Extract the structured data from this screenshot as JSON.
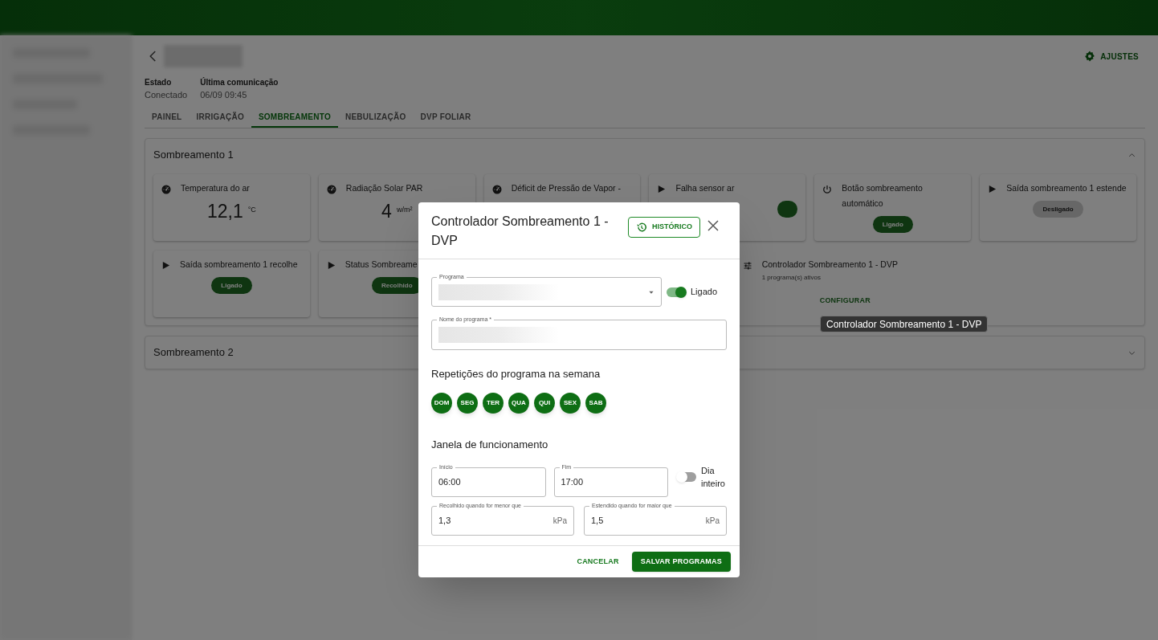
{
  "header": {
    "settings_button": "AJUSTES"
  },
  "status": [
    {
      "label": "Estado",
      "value": "Conectado"
    },
    {
      "label": "Última comunicação",
      "value": "06/09 09:45"
    }
  ],
  "tabs": [
    {
      "label": "PAINEL",
      "selected": false
    },
    {
      "label": "IRRIGAÇÃO",
      "selected": false
    },
    {
      "label": "SOMBREAMENTO",
      "selected": true
    },
    {
      "label": "NEBULIZAÇÃO",
      "selected": false
    },
    {
      "label": "DVP FOLIAR",
      "selected": false
    }
  ],
  "panels": [
    {
      "title": "Sombreamento 1",
      "expanded": true,
      "cards": [
        {
          "kind": "sensor",
          "title": "Temperatura do ar",
          "value": "12,1",
          "unit": "°C"
        },
        {
          "kind": "sensor",
          "title": "Radiação Solar PAR",
          "value": "4",
          "unit": "w/m²"
        },
        {
          "kind": "sensor",
          "title": "Déficit de Pressão de Vapor -"
        },
        {
          "kind": "output",
          "title": "Falha sensor ar",
          "badge_on": true
        },
        {
          "kind": "button",
          "title": "Botão sombreamento automático",
          "badge": "Ligado",
          "badge_on": true
        },
        {
          "kind": "output",
          "title": "Saída sombreamento 1 estende",
          "badge": "Desligado",
          "badge_on": false
        },
        {
          "kind": "output",
          "title": "Saída sombreamento 1 recolhe",
          "badge": "Ligado",
          "badge_on": true
        },
        {
          "kind": "output",
          "title": "Status Sombreame",
          "badge": "Recolhido",
          "badge_on": true
        },
        {
          "kind": "controller",
          "title": "Controlador Sombreamento 1 - DVP",
          "subtitle": "1 programa(s) ativos",
          "action": "CONFIGURAR"
        }
      ]
    },
    {
      "title": "Sombreamento 2",
      "expanded": false
    }
  ],
  "tooltip": "Controlador Sombreamento 1 - DVP",
  "dialog": {
    "title": "Controlador Sombreamento 1 - DVP",
    "history_button": "HISTÓRICO",
    "program": {
      "label": "Programa",
      "switch_label": "Ligado",
      "on": true
    },
    "name_field": {
      "label": "Nome do programa *"
    },
    "repeat_heading": "Repetições do programa na semana",
    "days": [
      {
        "label": "DOM",
        "selected": true
      },
      {
        "label": "SEG",
        "selected": true
      },
      {
        "label": "TER",
        "selected": true
      },
      {
        "label": "QUA",
        "selected": true
      },
      {
        "label": "QUI",
        "selected": true
      },
      {
        "label": "SEX",
        "selected": true
      },
      {
        "label": "SAB",
        "selected": true
      }
    ],
    "window_heading": "Janela de funcionamento",
    "start": {
      "label": "Início",
      "value": "06:00"
    },
    "end": {
      "label": "Fim",
      "value": "17:00"
    },
    "all_day": {
      "label": "Dia inteiro",
      "on": false
    },
    "low": {
      "label": "Recolhido quando for menor que",
      "value": "1,3",
      "unit": "kPa"
    },
    "high": {
      "label": "Estendido quando for maior que",
      "value": "1,5",
      "unit": "kPa"
    },
    "cancel_button": "CANCELAR",
    "save_button": "SALVAR PROGRAMAS"
  }
}
